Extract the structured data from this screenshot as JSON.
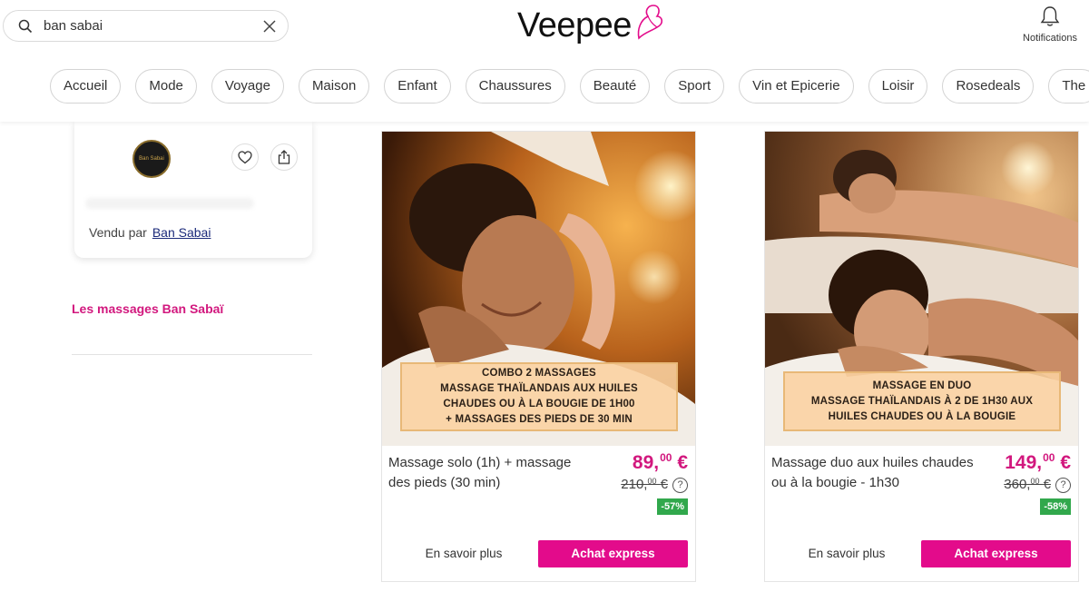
{
  "search": {
    "value": "ban sabai"
  },
  "brand": {
    "logo_text": "Veepee"
  },
  "header": {
    "notifications_label": "Notifications"
  },
  "nav": {
    "items": [
      "Accueil",
      "Mode",
      "Voyage",
      "Maison",
      "Enfant",
      "Chaussures",
      "Beauté",
      "Sport",
      "Vin et Epicerie",
      "Loisir",
      "Rosedeals",
      "The"
    ]
  },
  "seller": {
    "sold_by_label": "Vendu par",
    "seller_name": "Ban Sabai",
    "logo_text": "Ban Sabai"
  },
  "sidebar": {
    "link_label": "Les massages Ban Sabaï"
  },
  "products": [
    {
      "banner_lines": [
        "COMBO 2 MASSAGES",
        "MASSAGE THAÏLANDAIS AUX HUILES",
        "CHAUDES OU À LA BOUGIE DE 1H00",
        "+ MASSAGES DES PIEDS DE 30 MIN"
      ],
      "name": "Massage solo (1h) + massage des pieds (30 min)",
      "price_int": "89,",
      "price_dec": "00",
      "currency": "€",
      "old_price_int": "210,",
      "old_price_dec": "00",
      "discount": "-57%",
      "more_label": "En savoir plus",
      "buy_label": "Achat express"
    },
    {
      "banner_lines": [
        "MASSAGE EN DUO",
        "MASSAGE THAÏLANDAIS À 2 DE 1H30 AUX",
        "HUILES CHAUDES OU À LA BOUGIE"
      ],
      "name": "Massage duo aux huiles chaudes ou à la bougie - 1h30",
      "price_int": "149,",
      "price_dec": "00",
      "currency": "€",
      "old_price_int": "360,",
      "old_price_dec": "00",
      "discount": "-58%",
      "more_label": "En savoir plus",
      "buy_label": "Achat express"
    }
  ],
  "icons": {
    "search": "search-icon",
    "clear": "close-icon",
    "notifications": "bell-icon",
    "favorite": "heart-icon",
    "share": "share-icon",
    "help": "question-icon"
  },
  "colors": {
    "accent": "#e30b8b",
    "price": "#d2187e",
    "discount": "#31a84c"
  }
}
